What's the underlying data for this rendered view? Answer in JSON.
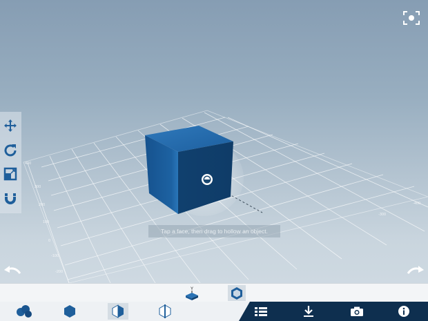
{
  "viewport": {
    "hint_text": "Tap a face, then drag to hollow an object.",
    "axis_label": "Y",
    "grid_labels": [
      "400",
      "300",
      "200",
      "100",
      "0",
      "-100",
      "-200",
      "-300",
      "-400"
    ]
  },
  "left_tools": [
    {
      "icon": "move-icon"
    },
    {
      "icon": "rotate-icon"
    },
    {
      "icon": "scale-icon"
    },
    {
      "icon": "magnet-icon"
    }
  ],
  "top_right": {
    "icon": "fullscreen-icon"
  },
  "history": {
    "undo_icon": "undo-icon",
    "redo_icon": "redo-icon"
  },
  "sub_toolbar": [
    {
      "icon": "align-y-icon",
      "active": false
    },
    {
      "icon": "hollow-icon",
      "active": true
    }
  ],
  "shape_tools": [
    {
      "icon": "blob-shape-icon",
      "active": false
    },
    {
      "icon": "hexagon-solid-icon",
      "active": false
    },
    {
      "icon": "half-cube-icon",
      "active": true
    },
    {
      "icon": "split-shape-icon",
      "active": false
    }
  ],
  "action_tools": [
    {
      "icon": "list-icon"
    },
    {
      "icon": "download-icon"
    },
    {
      "icon": "camera-icon"
    },
    {
      "icon": "info-icon"
    }
  ],
  "colors": {
    "accent": "#1b5d9c",
    "cube_front": "#1a5a98",
    "cube_right": "#124372",
    "cube_top": "#2a73b5",
    "dark_bar": "#0e2f4f",
    "icon_blue": "#1f5f9b"
  }
}
